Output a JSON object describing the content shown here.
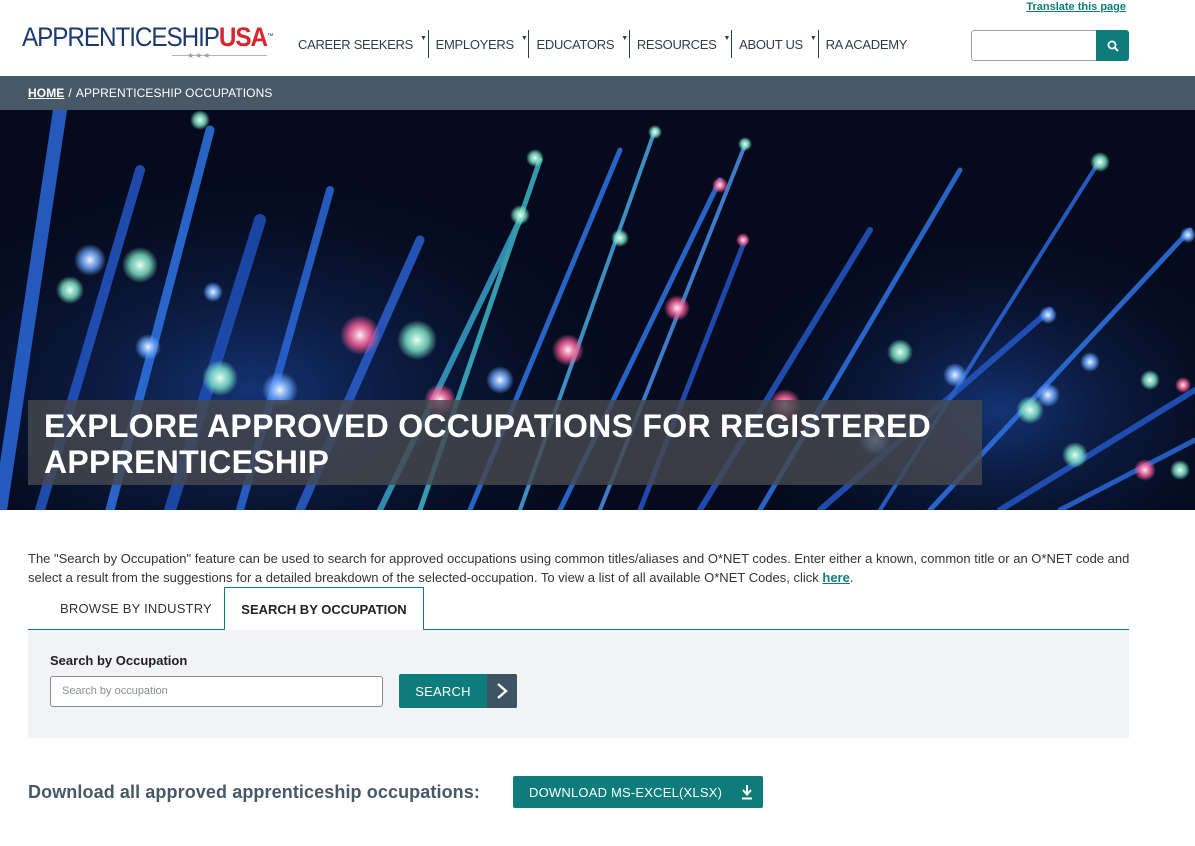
{
  "header": {
    "translate_link": "Translate this page",
    "logo": {
      "part1": "APPRENTICESHIP",
      "part2": "USA",
      "tm": "™",
      "stars": "★★★"
    },
    "nav": [
      {
        "label": "CAREER SEEKERS",
        "has_dropdown": true
      },
      {
        "label": "EMPLOYERS",
        "has_dropdown": true
      },
      {
        "label": "EDUCATORS",
        "has_dropdown": true
      },
      {
        "label": "RESOURCES",
        "has_dropdown": true
      },
      {
        "label": "ABOUT US",
        "has_dropdown": true
      },
      {
        "label": "RA ACADEMY",
        "has_dropdown": false
      }
    ],
    "search": {
      "value": "",
      "placeholder": "",
      "icon": "search-icon"
    }
  },
  "breadcrumb": {
    "home": "HOME",
    "separator": "/",
    "current": "APPRENTICESHIP OCCUPATIONS"
  },
  "hero": {
    "title": "EXPLORE APPROVED OCCUPATIONS FOR REGISTERED APPRENTICESHIP"
  },
  "intro": {
    "text": "The \"Search by Occupation\" feature can be used to search for approved occupations using common titles/aliases and O*NET codes. Enter either a known, common title or an O*NET code and select a result from the suggestions for a detailed breakdown of the selected-occupation. To view a list of all available O*NET Codes, click ",
    "link": "here",
    "end": "."
  },
  "tabs": [
    {
      "label": "BROWSE BY INDUSTRY",
      "active": false
    },
    {
      "label": "SEARCH BY OCCUPATION",
      "active": true
    }
  ],
  "search_panel": {
    "label": "Search by Occupation",
    "input_placeholder": "Search by occupation",
    "input_value": "",
    "button_label": "SEARCH",
    "button_icon": "chevron-right-icon"
  },
  "download": {
    "label": "Download all approved apprenticeship occupations:",
    "button_label": "DOWNLOAD MS-EXCEL(XLSX)",
    "button_icon": "download-icon"
  },
  "colors": {
    "brand_navy": "#1d3a6e",
    "brand_red": "#d8262e",
    "accent_teal": "#0e7c7b",
    "breadcrumb_bg": "#475866",
    "panel_bg": "#f2f3f4"
  }
}
